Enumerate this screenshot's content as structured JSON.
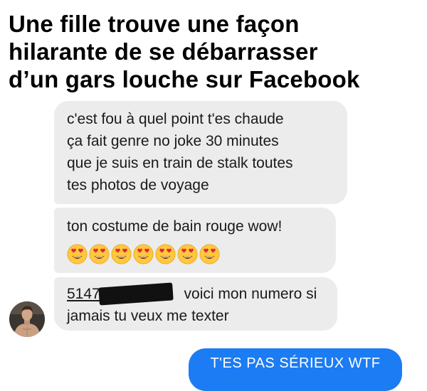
{
  "headline": {
    "line1": "Une fille trouve une façon",
    "line2": "hilarante de se débarrasser",
    "line3": "d’un gars louche sur Facebook"
  },
  "messages": [
    {
      "sender": "other",
      "lines": [
        "c'est fou à quel point t'es chaude",
        "ça fait genre no joke 30 minutes",
        "que je suis en train de stalk toutes",
        "tes photos de voyage"
      ]
    },
    {
      "sender": "other",
      "text": "ton costume de bain rouge wow!",
      "emoji_icon": "heart-eyes-emoji",
      "emoji_count": 7
    },
    {
      "sender": "other",
      "phone_visible": "5147",
      "phone_redacted": true,
      "line1_rest": " voici mon numero si",
      "line2": "jamais tu veux me texter"
    },
    {
      "sender": "me",
      "text": "T'ES PAS SÉRIEUX WTF"
    }
  ],
  "avatar_icon": "profile-avatar-shirtless-man",
  "colors": {
    "received_bubble": "#ececec",
    "sent_bubble": "#1b7cf4",
    "headline_text": "#000000",
    "redaction": "#111111"
  }
}
